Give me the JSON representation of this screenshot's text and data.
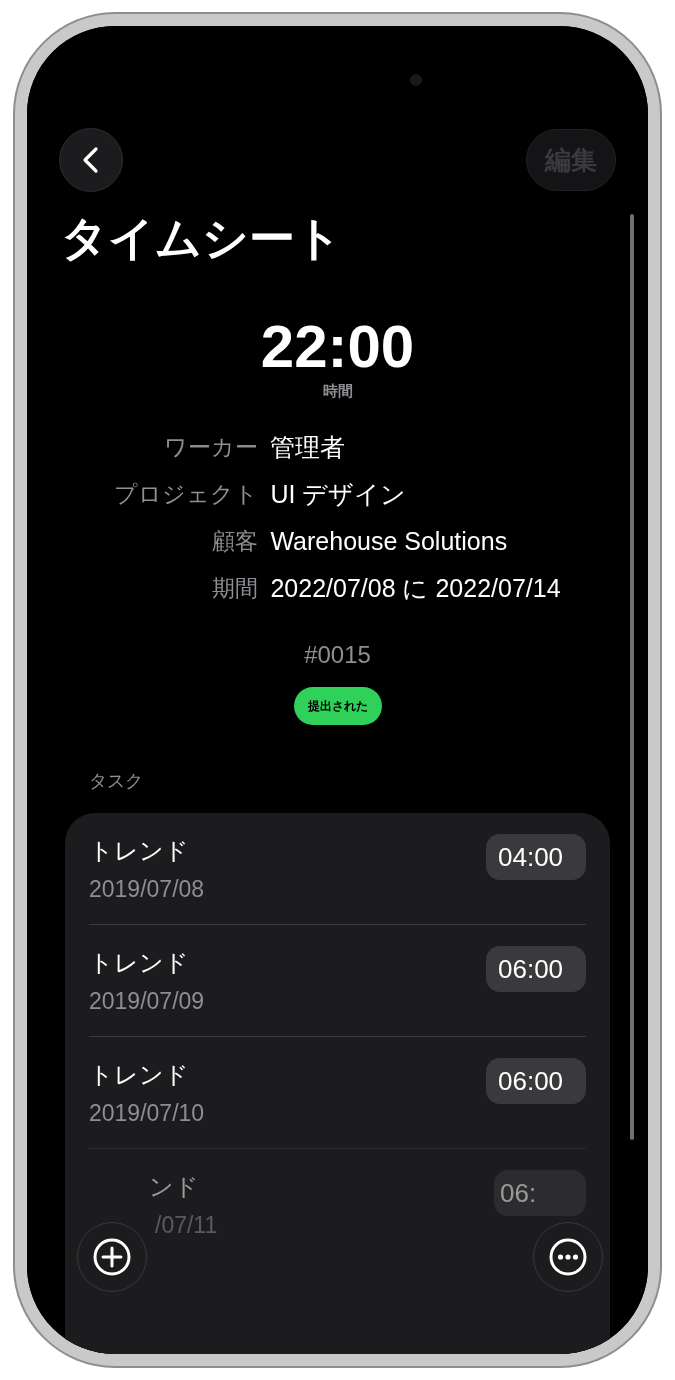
{
  "nav": {
    "back_button": {
      "kind": "back"
    },
    "edit_button": {
      "label": "編集",
      "disabled": true
    }
  },
  "title": "タイムシート",
  "total": {
    "value": "22:00",
    "caption": "時間"
  },
  "details": [
    {
      "label": "ワーカー",
      "value": "管理者"
    },
    {
      "label": "プロジェクト",
      "value": "UI デザイン"
    },
    {
      "label": "顧客",
      "value": "Warehouse Solutions"
    },
    {
      "label": "期間",
      "value": "2022/07/08 に 2022/07/14"
    }
  ],
  "number": "#0015",
  "status": {
    "label": "提出された",
    "color": "#30d158"
  },
  "tasks_header": "タスク",
  "tasks": [
    {
      "kind": "full",
      "title": "トレンド",
      "date": "2019/07/08",
      "hours": "04:00"
    },
    {
      "kind": "full",
      "title": "トレンド",
      "date": "2019/07/09",
      "hours": "06:00"
    },
    {
      "kind": "full",
      "title": "トレンド",
      "date": "2019/07/10",
      "hours": "06:00"
    },
    {
      "kind": "covered",
      "title": "ンド",
      "date": "/07/11",
      "hours": "06:"
    }
  ],
  "floating_buttons": [
    {
      "kind": "add"
    },
    {
      "kind": "more"
    }
  ]
}
